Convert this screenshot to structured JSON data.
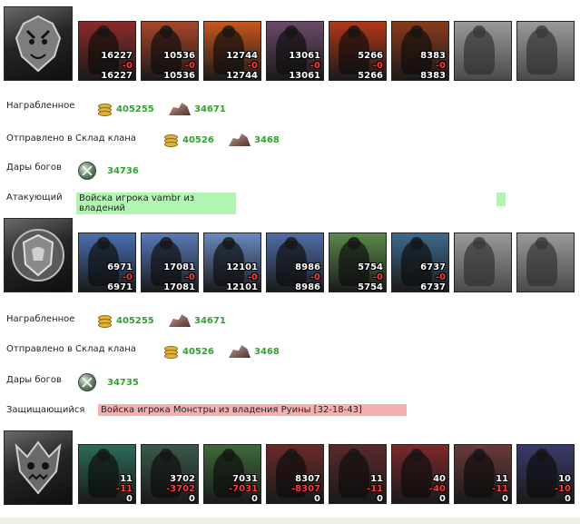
{
  "colors": {
    "value_green": "#2fa32f",
    "loss_red": "#ff3b3b",
    "attacker_bar": "#b2f5b2",
    "defender_bar": "#f4b0b0"
  },
  "sections": [
    {
      "emblem_icon": "demon-shield-emblem-icon",
      "units": [
        {
          "top": "16227",
          "mid": "-0",
          "bot": "16227",
          "color": "#8c2a2a"
        },
        {
          "top": "10536",
          "mid": "-0",
          "bot": "10536",
          "color": "#a8462a"
        },
        {
          "top": "12744",
          "mid": "-0",
          "bot": "12744",
          "color": "#c8561c"
        },
        {
          "top": "13061",
          "mid": "-0",
          "bot": "13061",
          "color": "#6b4a6a"
        },
        {
          "top": "5266",
          "mid": "-0",
          "bot": "5266",
          "color": "#b03818"
        },
        {
          "top": "8383",
          "mid": "-0",
          "bot": "8383",
          "color": "#8a3a1c"
        },
        {
          "gray": true
        },
        {
          "gray": true
        }
      ],
      "loot_label": "Награбленное",
      "loot_gold": "405255",
      "loot_ore": "34671",
      "sent_label": "Отправлено в Склад клана",
      "sent_gold": "40526",
      "sent_ore": "3468",
      "gifts_label": "Дары богов",
      "gifts_value": "34736",
      "role_label": "Атакующий",
      "army_text": "Войска игрока vambr из владений"
    },
    {
      "emblem_icon": "lion-shield-emblem-icon",
      "units": [
        {
          "top": "6971",
          "mid": "-0",
          "bot": "6971",
          "color": "#4a6fb0"
        },
        {
          "top": "17081",
          "mid": "-0",
          "bot": "17081",
          "color": "#5a7ab8"
        },
        {
          "top": "12101",
          "mid": "-0",
          "bot": "12101",
          "color": "#6a8ac0"
        },
        {
          "top": "8986",
          "mid": "-0",
          "bot": "8986",
          "color": "#4f6ea8"
        },
        {
          "top": "5754",
          "mid": "-0",
          "bot": "5754",
          "color": "#5a8a4a"
        },
        {
          "top": "6737",
          "mid": "-0",
          "bot": "6737",
          "color": "#3e6a8e"
        },
        {
          "gray": true
        },
        {
          "gray": true
        }
      ],
      "loot_label": "Награбленное",
      "loot_gold": "405255",
      "loot_ore": "34671",
      "sent_label": "Отправлено в Склад клана",
      "sent_gold": "40526",
      "sent_ore": "3468",
      "gifts_label": "Дары богов",
      "gifts_value": "34735",
      "role_label": "Защищающийся",
      "army_text": "Войска игрока Монстры из владения Руины [32-18-43]"
    },
    {
      "emblem_icon": "monster-skull-emblem-icon",
      "units": [
        {
          "top": "11",
          "mid": "-11",
          "bot": "0",
          "color": "#2d6a5a"
        },
        {
          "top": "3702",
          "mid": "-3702",
          "bot": "0",
          "color": "#3a5a4a"
        },
        {
          "top": "7031",
          "mid": "-7031",
          "bot": "0",
          "color": "#3f6a3a"
        },
        {
          "top": "8307",
          "mid": "-8307",
          "bot": "0",
          "color": "#6a2a2a"
        },
        {
          "top": "11",
          "mid": "-11",
          "bot": "0",
          "color": "#5a2a2a"
        },
        {
          "top": "40",
          "mid": "-40",
          "bot": "0",
          "color": "#7a2a2a"
        },
        {
          "top": "11",
          "mid": "-11",
          "bot": "0",
          "color": "#6a3a3a"
        },
        {
          "top": "10",
          "mid": "-10",
          "bot": "0",
          "color": "#3a3a6a"
        }
      ]
    }
  ]
}
